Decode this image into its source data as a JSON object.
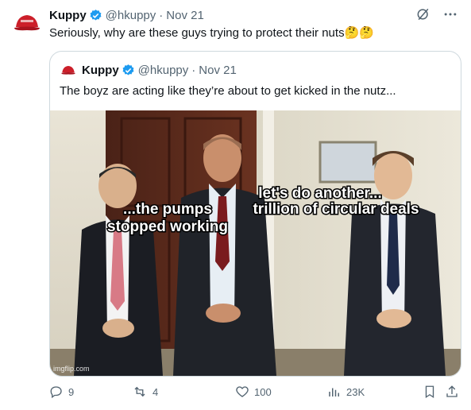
{
  "tweet": {
    "author_name": "Kuppy",
    "handle": "@hkuppy",
    "separator": "·",
    "date": "Nov 21",
    "text": "Seriously, why are these guys trying to protect their nuts🤔🤔",
    "avatar_icon": "red-cap-avatar-icon"
  },
  "quoted": {
    "author_name": "Kuppy",
    "handle": "@hkuppy",
    "separator": "·",
    "date": "Nov 21",
    "text": "The boyz are acting like they’re about to get kicked in the nutz...",
    "meme": {
      "caption_left_line1": "...the pumps",
      "caption_left_line2": "stopped working",
      "caption_right_line1": "let's do another...",
      "caption_right_line2": "trillion of circular deals",
      "watermark": "imgflip.com"
    }
  },
  "actions": {
    "replies": "9",
    "reposts": "4",
    "likes": "100",
    "views": "23K"
  },
  "colors": {
    "text": "#0f1419",
    "muted": "#536471",
    "verified": "#1d9bf0",
    "border": "#cfd9de"
  }
}
